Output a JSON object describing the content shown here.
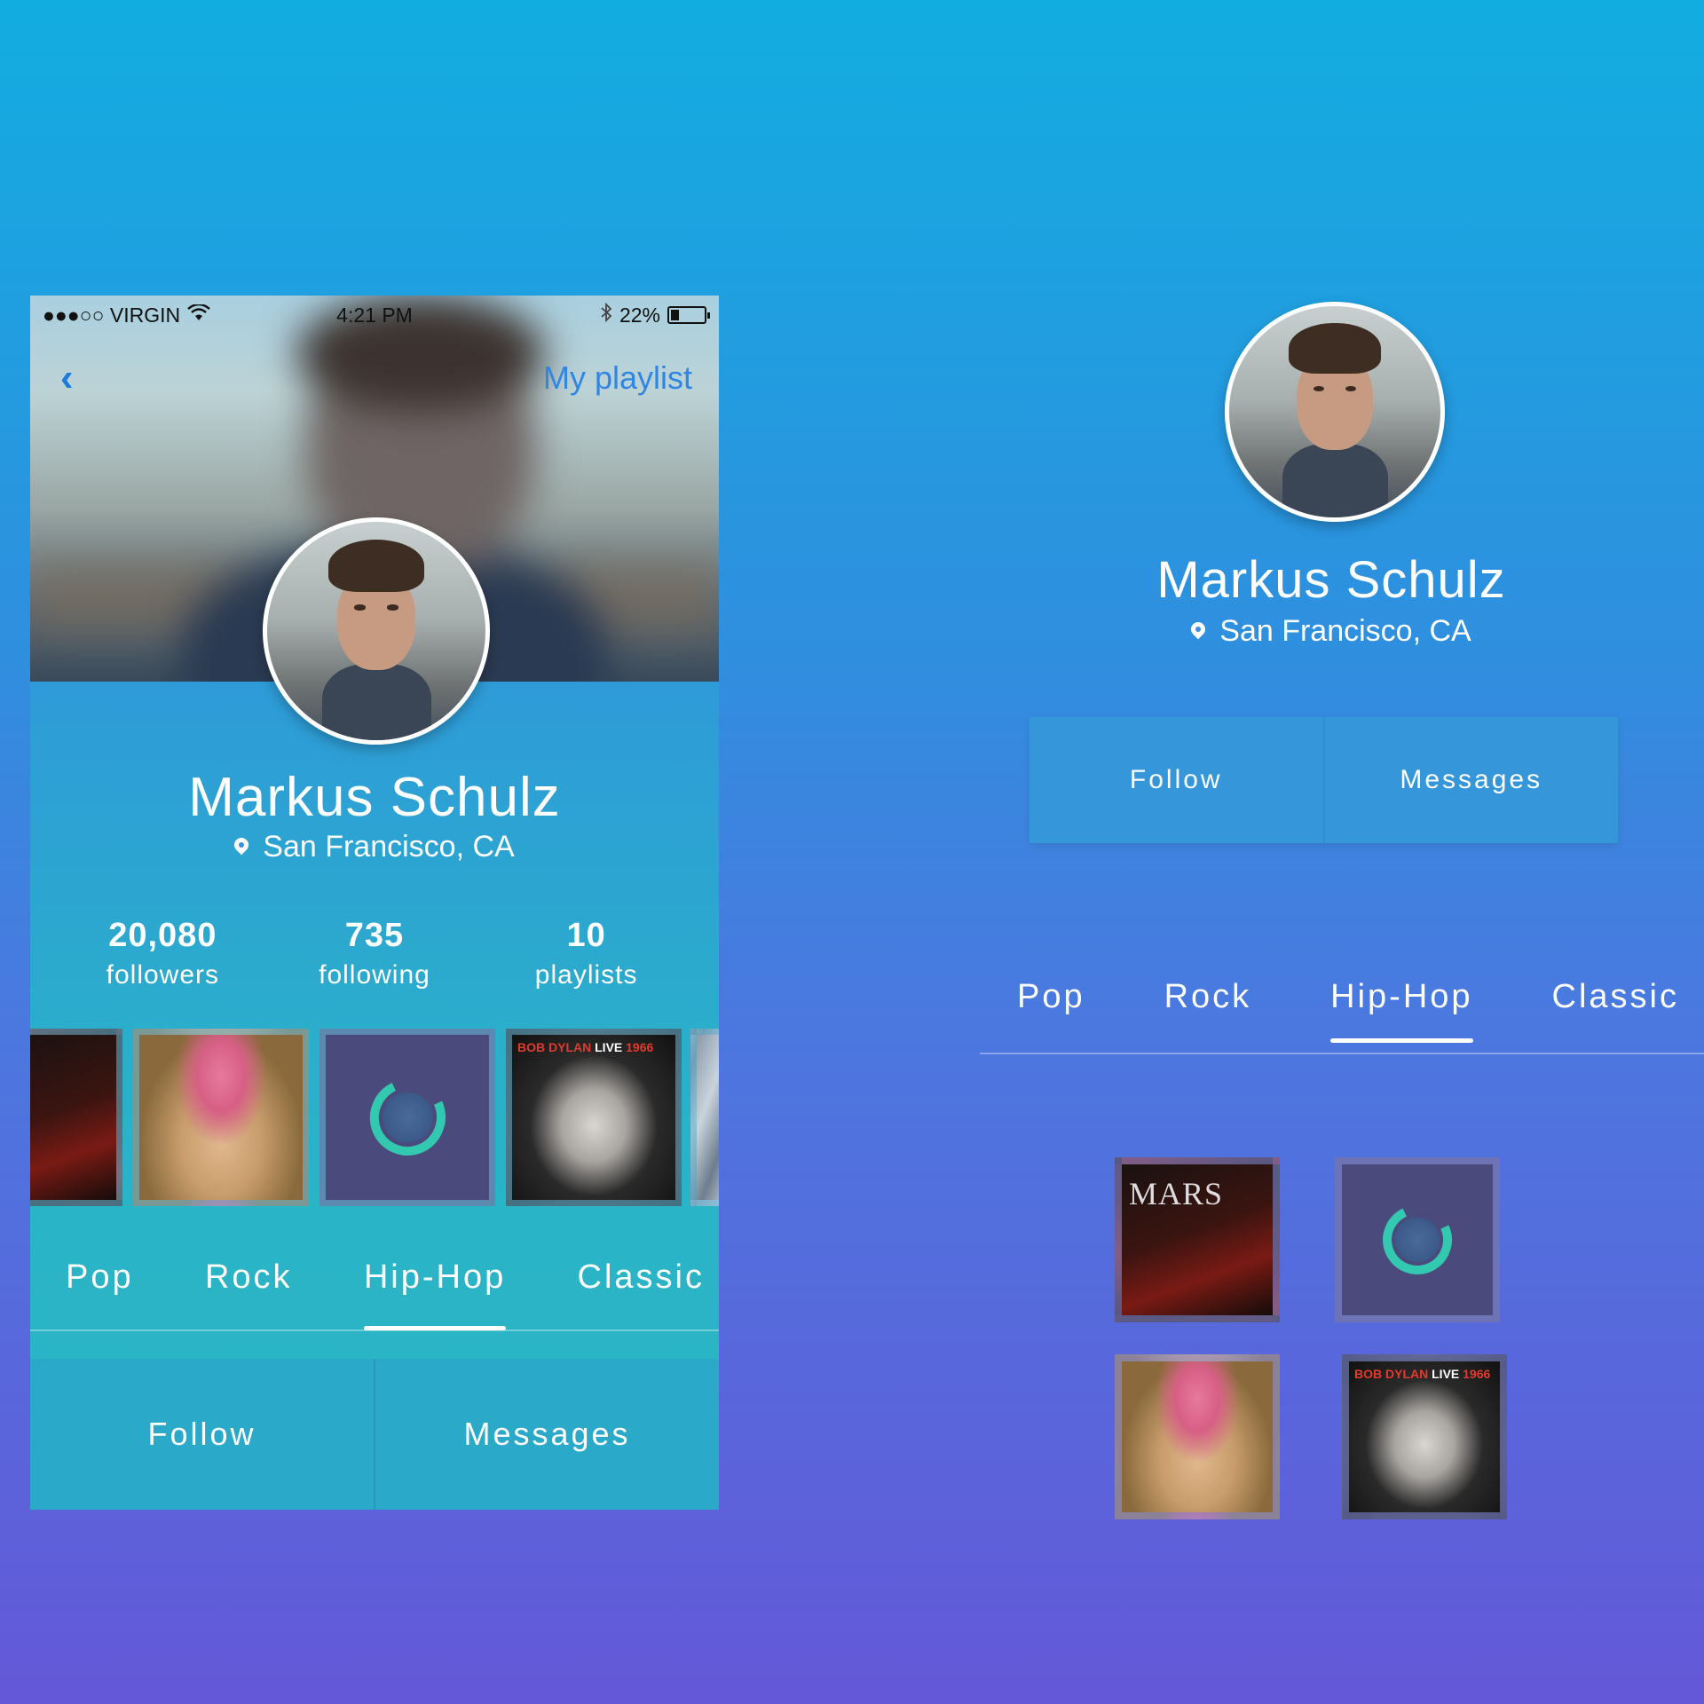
{
  "status_bar": {
    "carrier": "●●●○○ VIRGIN",
    "time": "4:21 PM",
    "battery": "22%",
    "battery_level": 0.22
  },
  "nav": {
    "back_icon": "‹",
    "playlist_label": "My playlist"
  },
  "profile": {
    "name": "Markus Schulz",
    "location": "San Francisco, CA"
  },
  "stats": [
    {
      "value": "20,080",
      "label": "followers"
    },
    {
      "value": "735",
      "label": "following"
    },
    {
      "value": "10",
      "label": "playlists"
    }
  ],
  "tabs": [
    {
      "label": "Pop"
    },
    {
      "label": "Rock"
    },
    {
      "label": "Hip-Hop",
      "active": true
    },
    {
      "label": "Classic"
    }
  ],
  "actions": {
    "follow": "Follow",
    "messages": "Messages"
  },
  "albums": {
    "mars_title": "MARS",
    "dylan_title_a": "BOB DYLAN",
    "dylan_title_b": "LIVE",
    "dylan_title_c": "1966"
  },
  "colors": {
    "accent_link": "#2f86e3",
    "ring": "#33c8b0"
  }
}
